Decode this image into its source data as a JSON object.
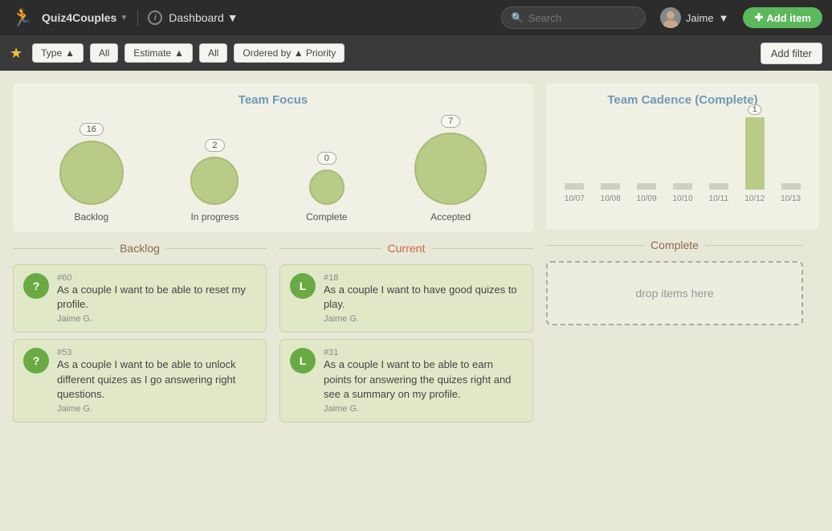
{
  "header": {
    "project_name": "Quiz4Couples",
    "dashboard_label": "Dashboard",
    "search_placeholder": "Search",
    "user_name": "Jaime",
    "add_item_label": "Add item",
    "chevron": "▼"
  },
  "filter_bar": {
    "type_label": "Type",
    "type_arrow": "▲",
    "type_value": "All",
    "estimate_label": "Estimate",
    "estimate_arrow": "▲",
    "estimate_value": "All",
    "ordered_by_label": "Ordered by",
    "ordered_by_arrow": "▲",
    "priority_label": "Priority",
    "add_filter_label": "Add filter"
  },
  "team_focus": {
    "title": "Team Focus",
    "items": [
      {
        "count": "16",
        "label": "Backlog",
        "size": 80
      },
      {
        "count": "2",
        "label": "In progress",
        "size": 60
      },
      {
        "count": "0",
        "label": "Complete",
        "size": 44
      },
      {
        "count": "7",
        "label": "Accepted",
        "size": 90
      }
    ]
  },
  "team_cadence": {
    "title": "Team Cadence (Complete)",
    "bars": [
      {
        "date": "10/07",
        "height": 8,
        "value": null
      },
      {
        "date": "10/08",
        "height": 8,
        "value": null
      },
      {
        "date": "10/09",
        "height": 8,
        "value": null
      },
      {
        "date": "10/10",
        "height": 8,
        "value": null
      },
      {
        "date": "10/11",
        "height": 8,
        "value": null
      },
      {
        "date": "10/12",
        "height": 90,
        "value": "1"
      },
      {
        "date": "10/13",
        "height": 8,
        "value": null
      }
    ]
  },
  "columns": {
    "backlog": {
      "title": "Backlog",
      "cards": [
        {
          "id": "#60",
          "icon": "?",
          "text_parts": [
            "As a couple I want to be able to reset",
            "my profile."
          ],
          "author": "Jaime G."
        },
        {
          "id": "#53",
          "icon": "?",
          "text_parts": [
            "As a couple I want to be able to",
            "unlock different quizes as I go",
            "answering right questions."
          ],
          "author": "Jaime G."
        }
      ]
    },
    "current": {
      "title": "Current",
      "cards": [
        {
          "id": "#18",
          "icon": "L",
          "text_parts": [
            "As a couple I want to have good",
            "quizes to play."
          ],
          "author": "Jaime G."
        },
        {
          "id": "#31",
          "icon": "L",
          "text_parts": [
            "As a couple I want to be able to earn",
            "points for answering the quizes right",
            "and see a summary on my profile."
          ],
          "author": "Jaime G."
        }
      ]
    },
    "complete": {
      "title": "Complete",
      "drop_text": "drop items here"
    }
  }
}
